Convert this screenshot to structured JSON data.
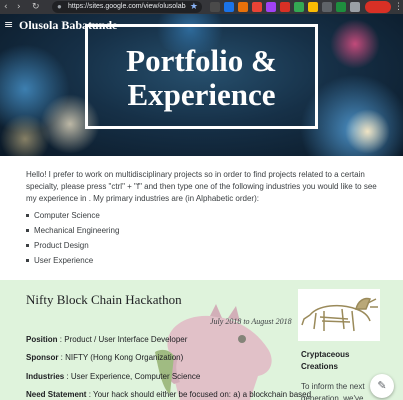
{
  "browser": {
    "url": "https://sites.google.com/view/olusolaba...",
    "icons": [
      "back-icon",
      "forward-icon",
      "reload-icon",
      "lock-icon",
      "star-icon",
      "menu-icon"
    ]
  },
  "site": {
    "title": "Olusola Babatunde",
    "hero_heading_line1": "Portfolio &",
    "hero_heading_line2": "Experience"
  },
  "intro": {
    "paragraph": "Hello! I prefer to work on multidisciplinary projects so in order to find projects related to a certain specialty, please press \"ctrl\" + \"f\" and then type one of the following industries you would like to see my experience in . My primary industries are (in Alphabetic order):",
    "industries": [
      "Computer Science",
      "Mechanical Engineering",
      "Product Design",
      "User Experience"
    ]
  },
  "project": {
    "title": "Nifty Block Chain Hackathon",
    "dates": "July 2018 to August 2018",
    "position_label": "Position",
    "position_value": " : Product / User Interface Developer",
    "sponsor_label": "Sponsor",
    "sponsor_value": " : NIFTY (Hong Kong Organization)",
    "industries_label": "Industries",
    "industries_value": " : User Experience, Computer Science",
    "need_label": "Need Statement",
    "need_value": " : Your hack should either be focused on: a) a blockchain based"
  },
  "card": {
    "title": "Cryptaceous Creations",
    "text": "To inform the next generation, we've"
  },
  "colors": {
    "section_bg": "#dff3dc",
    "hero_bg": "#163047",
    "chrome_bg": "#35363a"
  }
}
